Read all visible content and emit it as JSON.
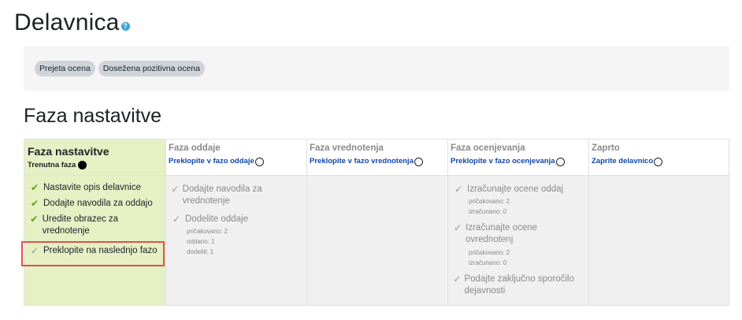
{
  "page": {
    "title": "Delavnica",
    "help_icon": "?"
  },
  "badges": [
    "Prejeta ocena",
    "Dosežena pozitivna ocena"
  ],
  "section_title": "Faza nastavitve",
  "phases": {
    "setup": {
      "name": "Faza nastavitve",
      "current_label": "Trenutna faza",
      "tasks": [
        {
          "label": "Nastavite opis delavnice",
          "status": "done"
        },
        {
          "label": "Dodajte navodila za oddajo",
          "status": "done"
        },
        {
          "label": "Uredite obrazec za vrednotenje",
          "status": "done"
        },
        {
          "label": "Preklopite na naslednjo fazo",
          "status": "todo"
        }
      ]
    },
    "submission": {
      "name": "Faza oddaje",
      "switch_label": "Preklopite v fazo oddaje",
      "tasks": [
        {
          "label": "Dodajte navodila za vrednotenje"
        },
        {
          "label": "Dodelite oddaje",
          "details": [
            "pričakovano: 2",
            "oddano: 1",
            "dodeliti: 1"
          ]
        }
      ]
    },
    "assessment": {
      "name": "Faza vrednotenja",
      "switch_label": "Preklopite v fazo vrednotenja"
    },
    "evaluation": {
      "name": "Faza ocenjevanja",
      "switch_label": "Preklopite v fazo ocenjevanja",
      "tasks": [
        {
          "label": "Izračunajte ocene oddaj",
          "details": [
            "pričakovano: 2",
            "izračunano: 0"
          ]
        },
        {
          "label": "Izračunajte ocene ovrednotenj",
          "details": [
            "pričakovano: 2",
            "izračunano: 0"
          ]
        },
        {
          "label": "Podajte zaključno sporočilo dejavnosti"
        }
      ]
    },
    "closed": {
      "name": "Zaprto",
      "switch_label": "Zaprite delavnico"
    }
  },
  "colors": {
    "active_phase_bg": "#e5f0c4",
    "inactive_phase_bg": "#f0f0f0",
    "link": "#0f47ad",
    "check_done": "#5da213",
    "highlight": "#e05050"
  }
}
